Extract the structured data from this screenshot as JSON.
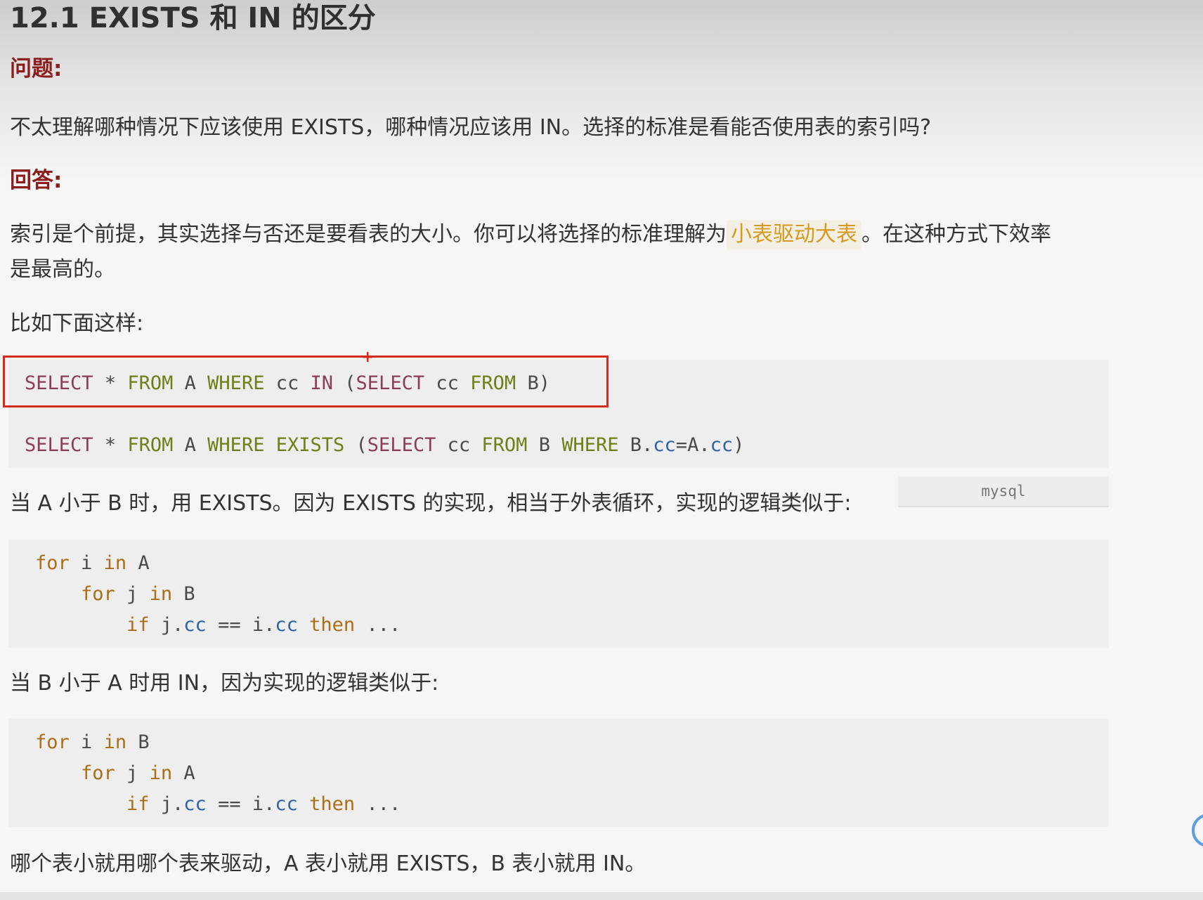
{
  "heading": "12.1 EXISTS 和 IN 的区分",
  "question_label": "问题:",
  "question_text": "不太理解哪种情况下应该使用 EXISTS，哪种情况应该用 IN。选择的标准是看能否使用表的索引吗?",
  "answer_label": "回答:",
  "answer_line1_before": "索引是个前提，其实选择与否还是要看表的大小。你可以将选择的标准理解为",
  "answer_highlight": "小表驱动大表",
  "answer_line1_after": "。在这种方式下效率",
  "answer_line2": "是最高的。",
  "example_intro": "比如下面这样:",
  "sql_code": {
    "line1": {
      "kw_select": "SELECT",
      "star": "*",
      "kw_from": "FROM",
      "tbl_a": "A",
      "kw_where": "WHERE",
      "col": "cc",
      "kw_in": "IN",
      "paren_open": "(",
      "kw_select2": "SELECT",
      "col2": "cc",
      "kw_from2": "FROM",
      "tbl_b": "B",
      "paren_close": ")"
    },
    "line2": {
      "kw_select": "SELECT",
      "star": "*",
      "kw_from": "FROM",
      "tbl_a": "A",
      "kw_where": "WHERE",
      "kw_exists": "EXISTS",
      "paren_open": "(",
      "kw_select2": "SELECT",
      "col2": "cc",
      "kw_from2": "FROM",
      "tbl_b": "B",
      "kw_where2": "WHERE",
      "b_prefix": "B.",
      "b_field": "cc",
      "eq": "=",
      "a_prefix": "A.",
      "a_field": "cc",
      "paren_close": ")"
    },
    "language": "mysql"
  },
  "exists_explain": "当 A 小于 B 时，用 EXISTS。因为 EXISTS 的实现，相当于外表循环，实现的逻辑类似于:",
  "loop1": {
    "l1_for": "for",
    "l1_i": "i",
    "l1_in": "in",
    "l1_t": "A",
    "l2_for": "for",
    "l2_j": "j",
    "l2_in": "in",
    "l2_t": "B",
    "l3_if": "if",
    "l3_j": "j.",
    "l3_jcc": "cc",
    "l3_eq": "==",
    "l3_i": "i.",
    "l3_icc": "cc",
    "l3_then": "then",
    "l3_dots": "..."
  },
  "in_explain": "当 B 小于 A 时用 IN，因为实现的逻辑类似于:",
  "loop2": {
    "l1_for": "for",
    "l1_i": "i",
    "l1_in": "in",
    "l1_t": "B",
    "l2_for": "for",
    "l2_j": "j",
    "l2_in": "in",
    "l2_t": "A",
    "l3_if": "if",
    "l3_j": "j.",
    "l3_jcc": "cc",
    "l3_eq": "==",
    "l3_i": "i.",
    "l3_icc": "cc",
    "l3_then": "then",
    "l3_dots": "..."
  },
  "conclusion": "哪个表小就用哪个表来驱动，A 表小就用 EXISTS，B 表小就用 IN。",
  "annotation_marker": "+",
  "colors": {
    "section_label": "#8c1d1d",
    "highlight_text": "#d69a1e",
    "annotation_box": "#d52b1e",
    "sql_keyword": "#8e3b5a",
    "sql_from_where": "#6f7f16",
    "loop_keyword": "#aa6f16"
  }
}
